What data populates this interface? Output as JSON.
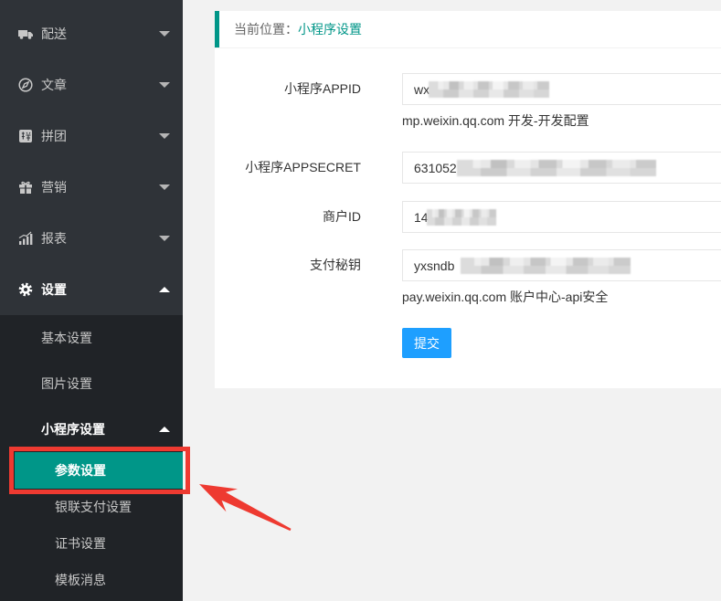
{
  "theme": {
    "accent": "#009688",
    "primary_button": "#1e9fff",
    "sidebar_bg": "#2f3338",
    "submenu_bg": "#202327",
    "annotation": "#ee3a31"
  },
  "sidebar": {
    "menu": [
      {
        "label": "配送",
        "icon": "truck-icon",
        "expanded": false
      },
      {
        "label": "文章",
        "icon": "compass-icon",
        "expanded": false
      },
      {
        "label": "拼团",
        "icon": "group-buy-icon",
        "expanded": false
      },
      {
        "label": "营销",
        "icon": "gift-icon",
        "expanded": false
      },
      {
        "label": "报表",
        "icon": "chart-icon",
        "expanded": false
      },
      {
        "label": "设置",
        "icon": "gear-icon",
        "expanded": true
      }
    ],
    "settings_children": [
      {
        "label": "基本设置"
      },
      {
        "label": "图片设置"
      },
      {
        "label": "小程序设置",
        "expanded": true
      }
    ],
    "miniprogram_children": [
      {
        "label": "参数设置",
        "active": true
      },
      {
        "label": "银联支付设置"
      },
      {
        "label": "证书设置"
      },
      {
        "label": "模板消息"
      }
    ]
  },
  "breadcrumb": {
    "prefix": "当前位置：",
    "current": "小程序设置"
  },
  "form": {
    "fields": [
      {
        "label": "小程序APPID",
        "value": "wx",
        "redacted": true,
        "help": "mp.weixin.qq.com 开发-开发配置"
      },
      {
        "label": "小程序APPSECRET",
        "value": "631052",
        "redacted": true
      },
      {
        "label": "商户ID",
        "value": "14",
        "redacted": true
      },
      {
        "label": "支付秘钥",
        "value": "yxsndb",
        "redacted": true,
        "help": "pay.weixin.qq.com 账户中心-api安全"
      }
    ],
    "submit_label": "提交"
  },
  "annotation": {
    "highlight_box": true,
    "arrow": true
  }
}
